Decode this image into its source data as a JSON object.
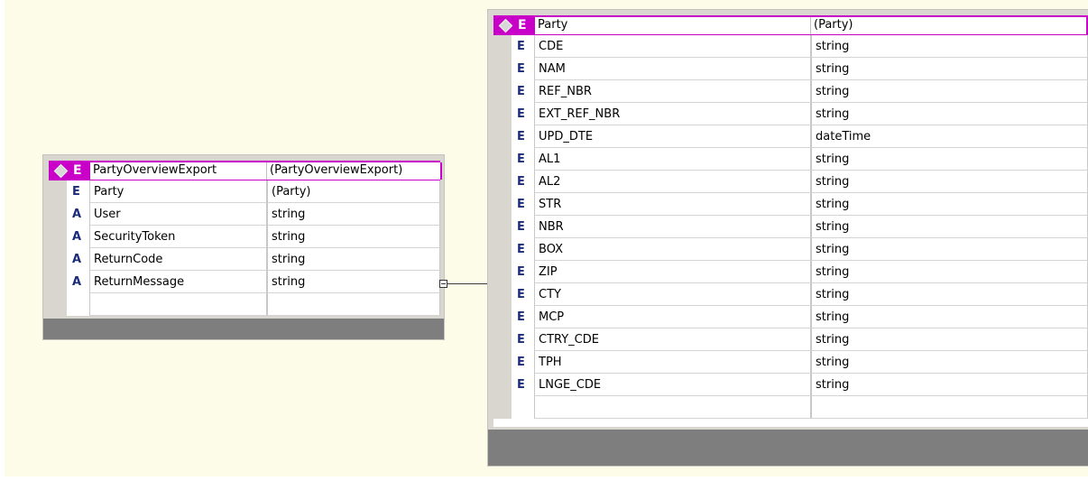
{
  "left_table": {
    "header": {
      "kind": "E",
      "name": "PartyOverviewExport",
      "type": "(PartyOverviewExport)"
    },
    "rows": [
      {
        "kind": "E",
        "name": "Party",
        "type": "(Party)"
      },
      {
        "kind": "A",
        "name": "User",
        "type": "string"
      },
      {
        "kind": "A",
        "name": "SecurityToken",
        "type": "string"
      },
      {
        "kind": "A",
        "name": "ReturnCode",
        "type": "string"
      },
      {
        "kind": "A",
        "name": "ReturnMessage",
        "type": "string"
      }
    ]
  },
  "right_table": {
    "header": {
      "kind": "E",
      "name": "Party",
      "type": "(Party)"
    },
    "rows": [
      {
        "kind": "E",
        "name": "CDE",
        "type": "string"
      },
      {
        "kind": "E",
        "name": "NAM",
        "type": "string"
      },
      {
        "kind": "E",
        "name": "REF_NBR",
        "type": "string"
      },
      {
        "kind": "E",
        "name": "EXT_REF_NBR",
        "type": "string"
      },
      {
        "kind": "E",
        "name": "UPD_DTE",
        "type": "dateTime"
      },
      {
        "kind": "E",
        "name": "AL1",
        "type": "string"
      },
      {
        "kind": "E",
        "name": "AL2",
        "type": "string"
      },
      {
        "kind": "E",
        "name": "STR",
        "type": "string"
      },
      {
        "kind": "E",
        "name": "NBR",
        "type": "string"
      },
      {
        "kind": "E",
        "name": "BOX",
        "type": "string"
      },
      {
        "kind": "E",
        "name": "ZIP",
        "type": "string"
      },
      {
        "kind": "E",
        "name": "CTY",
        "type": "string"
      },
      {
        "kind": "E",
        "name": "MCP",
        "type": "string"
      },
      {
        "kind": "E",
        "name": "CTRY_CDE",
        "type": "string"
      },
      {
        "kind": "E",
        "name": "TPH",
        "type": "string"
      },
      {
        "kind": "E",
        "name": "LNGE_CDE",
        "type": "string"
      }
    ]
  },
  "colors": {
    "background": "#fdfce8",
    "header_accent": "#c800c8",
    "kind_letter": "#1c2c7a",
    "frame": "#d9d6cf",
    "footer": "#7f7e7e"
  }
}
